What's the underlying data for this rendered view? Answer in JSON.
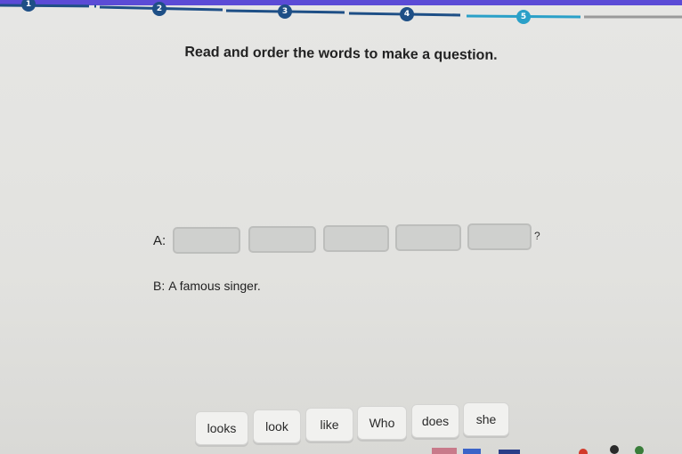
{
  "progress": {
    "steps": [
      "1",
      "2",
      "3",
      "4",
      "5"
    ],
    "current_step": "5"
  },
  "instructions": "Read and order the words to make a question.",
  "question": {
    "speaker_a": "A:",
    "answer_slot_count": 5,
    "end_mark": "?",
    "speaker_b": "B:",
    "response": "A famous singer."
  },
  "word_bank": [
    "looks",
    "look",
    "like",
    "Who",
    "does",
    "she"
  ],
  "colors": {
    "accent": "#2aa0c8",
    "step_dark": "#1e4f86",
    "top_strip": "#5b4bd6"
  }
}
